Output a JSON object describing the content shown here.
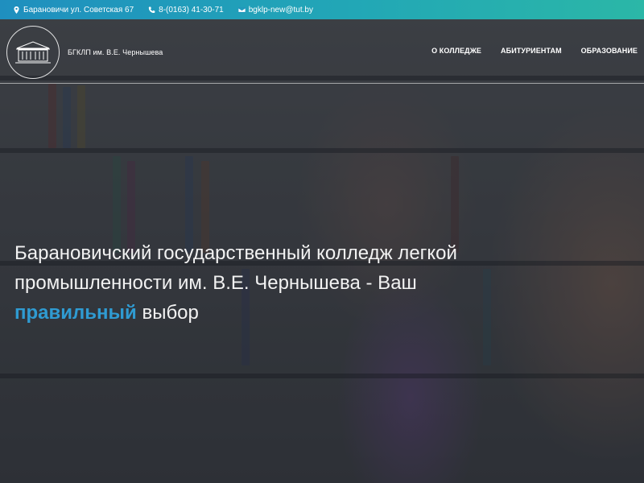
{
  "topbar": {
    "address": "Барановичи ул. Советская 67",
    "phone": "8-(0163) 41-30-71",
    "email": "bgklp-new@tut.by"
  },
  "header": {
    "logo_text": "БГКЛП им. В.Е. Чернышева",
    "nav": [
      {
        "label": "О КОЛЛЕДЖЕ"
      },
      {
        "label": "АБИТУРИЕНТАМ"
      },
      {
        "label": "ОБРАЗОВАНИЕ"
      }
    ]
  },
  "hero": {
    "headline_part1": "Барановичский государственный колледж легкой промышленности им. В.Е. Чернышева - Ваш",
    "headline_accent": "правильный",
    "headline_part2": "выбор"
  },
  "colors": {
    "accent": "#2f9bd2",
    "topbar_start": "#1f8fbf",
    "topbar_end": "#2bb7a7"
  },
  "icons": [
    "location-pin-icon",
    "phone-icon",
    "envelope-icon",
    "college-building-icon"
  ]
}
